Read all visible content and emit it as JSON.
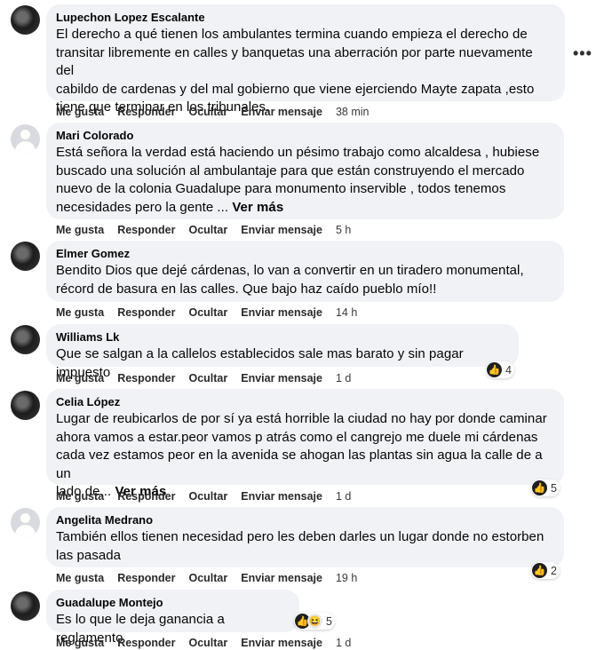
{
  "actions": {
    "like": "Me gusta",
    "reply": "Responder",
    "hide": "Ocultar",
    "message": "Enviar mensaje"
  },
  "more_options_icon": "more-options-icon",
  "see_more_label": "Ver más",
  "comments": [
    {
      "author": "Lupechon Lopez Escalante",
      "lines": [
        "El derecho a qué tienen los ambulantes termina cuando empieza el derecho de",
        "transitar libremente en calles y banquetas una aberración por parte nuevamente del",
        "cabildo de cardenas y del mal gobierno que viene ejerciendo Mayte zapata ,esto",
        "tiene que terminar en los tribunales."
      ],
      "time": "38 min"
    },
    {
      "author": "Mari Colorado",
      "lines": [
        "Está señora la verdad está haciendo un pésimo trabajo como alcaldesa , hubiese",
        "buscado una solución al ambulantaje para que están construyendo el mercado",
        "nuevo de la colonia Guadalupe para monumento inservible , todos tenemos",
        "necesidades pero la gente ... "
      ],
      "time": "5 h"
    },
    {
      "author": "Elmer Gomez",
      "lines": [
        "Bendito Dios que dejé cárdenas, lo van a convertir en un tiradero monumental,",
        "récord de basura en las calles. Que bajo haz caído pueblo mío!!"
      ],
      "time": "14 h"
    },
    {
      "author": "Williams Lk",
      "lines": [
        "Que se salgan a la callelos establecidos sale mas barato y sin pagar impuesto"
      ],
      "time": "1 d",
      "reaction_count": "4"
    },
    {
      "author": "Celia López",
      "lines": [
        "Lugar de reubicarlos de por sí ya está horrible la ciudad no hay por donde caminar",
        "ahora vamos a estar.peor vamos p atrás como el cangrejo me duele mi cárdenas",
        "cada vez estamos peor en la avenida se ahogan las plantas sin agua la calle de a un",
        "lado de... "
      ],
      "time": "1 d",
      "reaction_count": "5"
    },
    {
      "author": "Angelita Medrano",
      "lines": [
        "También ellos tienen necesidad pero les deben darles un lugar donde no estorben",
        "las pasada"
      ],
      "time": "19 h",
      "reaction_count": "2"
    },
    {
      "author": "Guadalupe Montejo",
      "lines": [
        "Es lo que le deja ganancia a reglamento"
      ],
      "time": "1 d",
      "reaction_count": "5"
    }
  ]
}
